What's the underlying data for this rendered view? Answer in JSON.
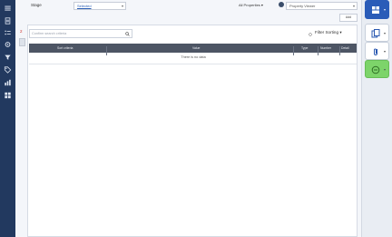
{
  "toolbar": {
    "field_label": "Stage",
    "select_value": "Selected",
    "settings_link": "All Properties ▾",
    "dropdown_value": "Property Viewer",
    "small_button": "Add"
  },
  "panel": {
    "marker": "2",
    "search_placeholder": "Confirm search criteria",
    "sort_label": "Filter Sorting ▾",
    "columns": [
      "Sort criteria",
      "Value",
      "Type",
      "Number",
      "Detail"
    ],
    "empty_message": "There is no data"
  },
  "icons": {
    "left_rail": [
      "menu-icon",
      "document-icon",
      "list-icon",
      "settings-icon",
      "filter-icon",
      "tag-icon",
      "chart-icon",
      "grid-icon"
    ],
    "right_bar": [
      "view-icon",
      "copy-icon",
      "attachment-icon",
      "minus-icon"
    ]
  },
  "colors": {
    "rail": "#22395f",
    "header": "#4d5564",
    "accent": "#2a5cb8",
    "green": "#7dd46a",
    "marker": "#d0312d"
  }
}
